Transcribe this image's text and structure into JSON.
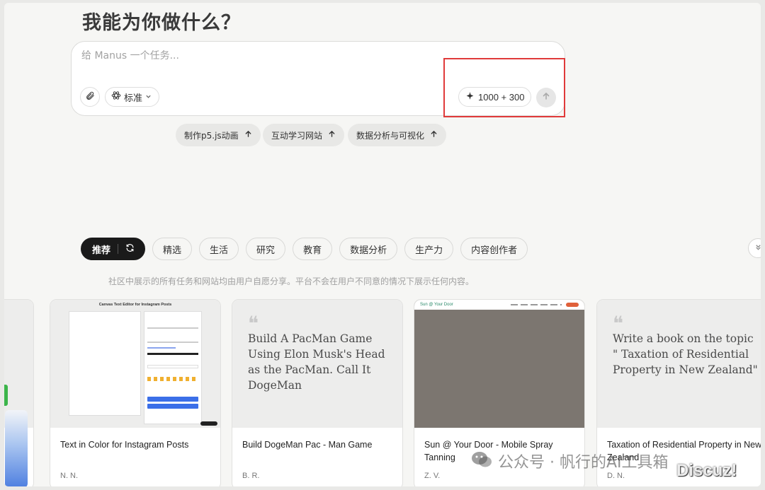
{
  "heading": "我能为你做什么？",
  "composer": {
    "placeholder": "给 Manus 一个任务...",
    "mode_label": "标准",
    "credits_label": "1000 + 300"
  },
  "suggestions": [
    {
      "label": "制作p5.js动画"
    },
    {
      "label": "互动学习网站"
    },
    {
      "label": "数据分析与可视化"
    }
  ],
  "categories": {
    "active": "推荐",
    "items": [
      "精选",
      "生活",
      "研究",
      "教育",
      "数据分析",
      "生产力",
      "内容创作者"
    ]
  },
  "notice": "社区中展示的所有任务和网站均由用户自愿分享。平台不会在用户不同意的情况下展示任何内容。",
  "cards": [
    {
      "preview_title": "Canvas Text Editor for Instagram Posts",
      "title": "Text in Color for Instagram Posts",
      "author": "N. N."
    },
    {
      "quote": "Build A PacMan Game Using Elon Musk's Head as the PacMan. Call It DogeMan",
      "title": "Build DogeMan Pac - Man Game",
      "author": "B. R."
    },
    {
      "preview_brand": "Sun @ Your Door",
      "title": "Sun @ Your Door - Mobile Spray Tanning",
      "author": "Z. V."
    },
    {
      "quote": "Write a book on the topic \" Taxation of Residential Property in New Zealand\"",
      "title": "Taxation of Residential Property in New Zealand",
      "author": "D. N."
    }
  ],
  "watermark": {
    "wechat": "公众号 · 帆行的AI工具箱",
    "discuz": "Discuz!"
  },
  "colors": {
    "highlight": "#e03a3a",
    "active_chip": "#1a1a1a",
    "page_bg": "#f6f6f4"
  }
}
